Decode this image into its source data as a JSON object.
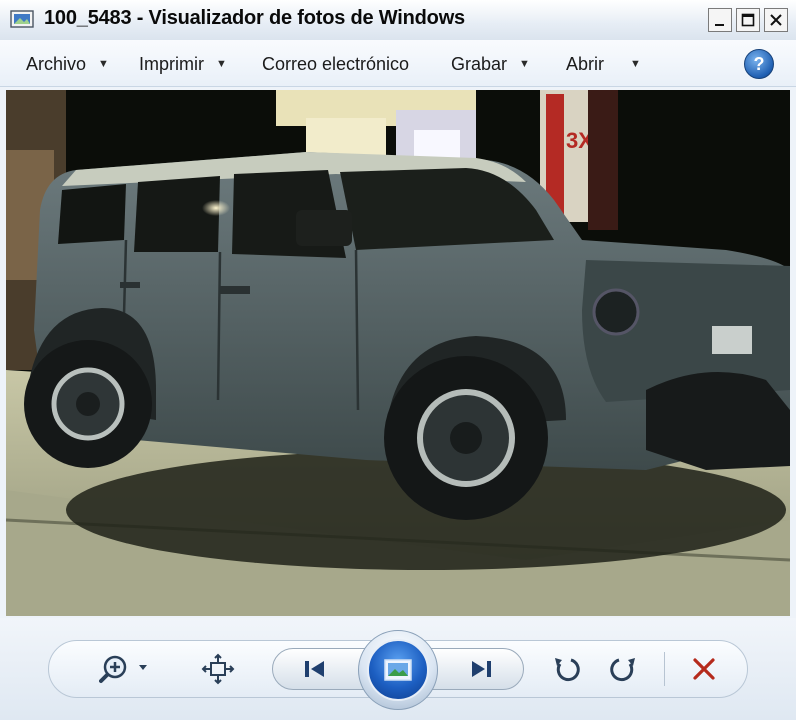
{
  "window": {
    "title": "100_5483 - Visualizador de fotos de Windows",
    "controls": {
      "minimize": "_",
      "maximize": "□",
      "close": "✕"
    }
  },
  "menu": {
    "items": [
      {
        "label": "Archivo",
        "has_dropdown": true
      },
      {
        "label": "Imprimir",
        "has_dropdown": true
      },
      {
        "label": "Correo electrónico",
        "has_dropdown": false
      },
      {
        "label": "Grabar",
        "has_dropdown": true
      },
      {
        "label": "Abrir",
        "has_dropdown": true
      }
    ],
    "help_label": "?"
  },
  "photo": {
    "sign_text": "3X",
    "vehicle_color": "#58666a",
    "ground_color": "#b7b89a"
  },
  "toolbar": {
    "zoom_icon": "zoom-icon",
    "fit_icon": "fit-to-window-icon",
    "prev_icon": "previous-icon",
    "slideshow_icon": "slideshow-icon",
    "next_icon": "next-icon",
    "rotate_ccw_icon": "rotate-counterclockwise-icon",
    "rotate_cw_icon": "rotate-clockwise-icon",
    "delete_icon": "delete-icon",
    "delete_color": "#b52a1c"
  }
}
